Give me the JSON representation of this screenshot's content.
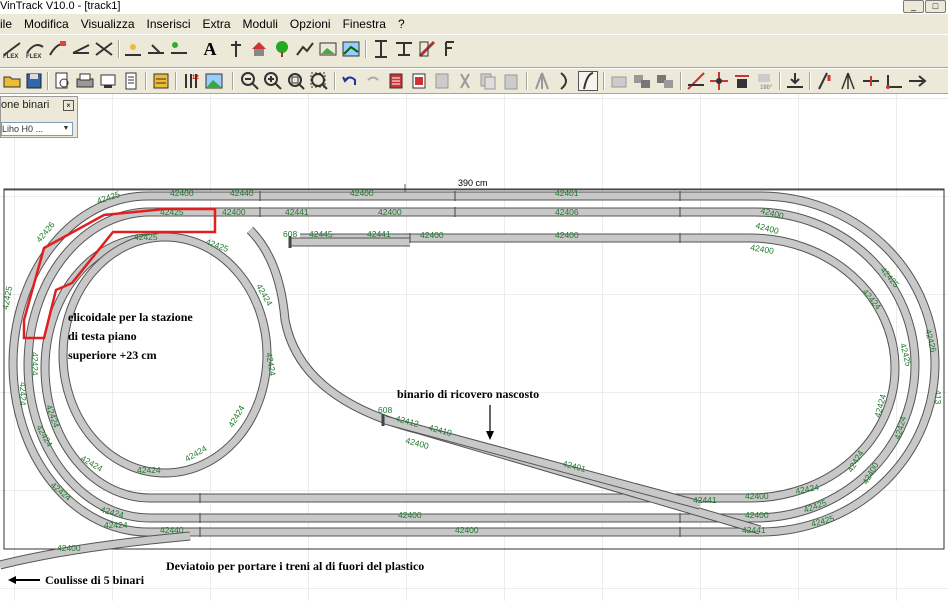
{
  "window": {
    "title": "VinTrack  V10.0 - [track1]",
    "buttons": [
      "_",
      "□"
    ]
  },
  "menubar": [
    "ile",
    "Modifica",
    "Visualizza",
    "Inserisci",
    "Extra",
    "Moduli",
    "Opzioni",
    "Finestra",
    "?"
  ],
  "toolbar_top": {
    "icons": [
      "flex-track-icon",
      "flex-track-2-icon",
      "curve-icon",
      "turnout-icon",
      "crossing-icon",
      "ruler-icon",
      "connect-icon",
      "text-tool-icon",
      "signal-icon",
      "building-icon",
      "tree-icon",
      "landscape-icon",
      "picture-icon",
      "height-icon",
      "ramp-icon",
      "pen-icon",
      "scale-icon"
    ],
    "text_label": "A"
  },
  "toolbar_bottom": {
    "icons": [
      "open-icon",
      "save-icon",
      "preview-icon",
      "print-icon",
      "print-setup-icon",
      "page-icon",
      "library-icon",
      "grid-icon",
      "image-icon",
      "zoom-out-icon",
      "zoom-in-icon",
      "zoom-window-icon",
      "zoom-fit-icon",
      "undo-icon",
      "redo-icon",
      "copy-icon",
      "paste-icon",
      "cut-icon",
      "delete-icon",
      "clipboard-icon",
      "clipboard-2-icon",
      "switch-icon",
      "curve-tool-icon",
      "flex-tool-icon",
      "group-icon",
      "ungroup-icon",
      "arrange-icon",
      "measure-icon",
      "move-icon",
      "rotate-icon",
      "rotate-180-icon",
      "align-icon",
      "split-icon",
      "join-icon",
      "cut-track-icon",
      "connect-track-icon",
      "end-icon"
    ]
  },
  "panel": {
    "title": "one binari",
    "close": "×",
    "select_value": "Liho H0 ..."
  },
  "layout": {
    "dimension_label": "390 cm",
    "track_labels": {
      "t1": "42400",
      "t2": "42440",
      "t3": "42400",
      "t4": "42401",
      "t5": "42425",
      "t6": "42400",
      "t7": "42441",
      "t8": "42400",
      "t9": "42406",
      "t10": "42425",
      "t11": "608",
      "t12": "42445",
      "t13": "42441",
      "t14": "42400",
      "t15": "42400",
      "t16": "42425",
      "t17": "42426",
      "t18": "42425",
      "t19": "42424",
      "t20": "42424",
      "t21": "42424",
      "t22": "42424",
      "t23": "42424",
      "t24": "42424",
      "t25": "42425",
      "t26": "42424",
      "t27": "42424",
      "t28": "42424",
      "t29": "42424",
      "t30": "42400",
      "t31": "42412",
      "t32": "42410",
      "t33": "42400",
      "t34": "42401",
      "t35": "42400",
      "t36": "42400",
      "t37": "42440",
      "t38": "42441",
      "t39": "42400",
      "t40": "42441",
      "t41": "42400",
      "t42": "42424",
      "t43": "42425",
      "t44": "42425",
      "t45": "42424",
      "t46": "42400",
      "t47": "42400",
      "t48": "42425",
      "t49": "42426",
      "t50": "42424",
      "t51": "42400",
      "t52": "42425",
      "t53": "42424",
      "t54": "42424",
      "t55": "42424",
      "t56": "42440",
      "t57": "42400",
      "t58": "608",
      "t59": "413",
      "t60": "42412",
      "t61": "42424",
      "t62": "42424",
      "t63": "42400",
      "t64": "42401"
    },
    "annotations": {
      "helix_line1": "elicoidale per la stazione",
      "helix_line2": "di testa piano",
      "helix_line3": "superiore +23 cm",
      "hidden_track": "binario di ricovero nascosto",
      "deviatoio": "Deviatoio per portare i treni al di fuori del plastico",
      "coulisse": "Coulisse di 5 binari"
    },
    "colors": {
      "track_fill": "#c8c8c8",
      "track_stroke": "#555555",
      "label_green": "#1f7a2e",
      "highlight_red": "#e02020"
    }
  }
}
